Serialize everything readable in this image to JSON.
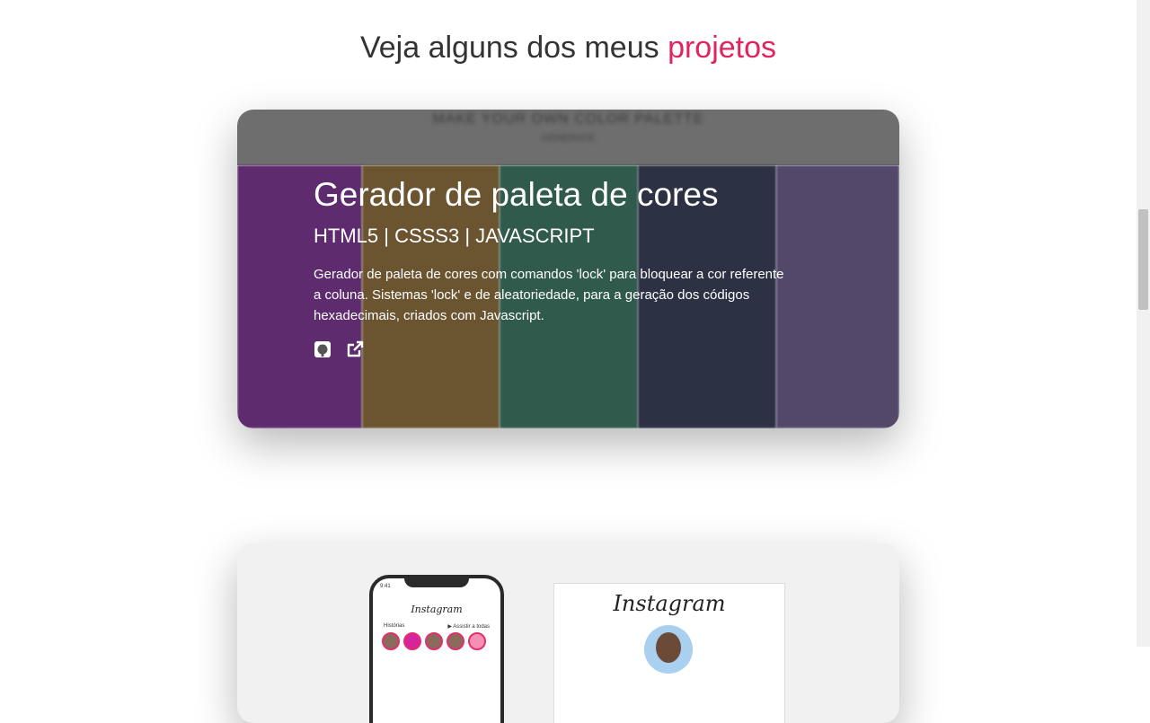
{
  "section": {
    "heading_prefix": "Veja alguns dos meus",
    "heading_accent": "projetos",
    "accent_color": "#e0245e"
  },
  "project": {
    "title": "Gerador de paleta de cores",
    "tech": "HTML5 | CSSS3 | JAVASCRIPT",
    "description": "Gerador de paleta de cores com comandos 'lock' para bloquear a cor referente a coluna. Sistemas 'lock' e de aleatoriedade, para a geração dos códigos hexadecimais, criados com Javascript.",
    "links": [
      {
        "icon": "github-icon"
      },
      {
        "icon": "external-link-icon"
      }
    ],
    "background_top_title": "MAKE YOUR OWN COLOR PALETTE",
    "background_top_subtitle": "GENERATE",
    "palette_colors": [
      "#5e2b6e",
      "#6b5430",
      "#2f5a4c",
      "#2c3244",
      "#53486a"
    ]
  },
  "project2": {
    "phone_status": "9:41",
    "phone_app_name": "Instagram",
    "phone_stories_label": "Histórias",
    "phone_watch_all": "▶ Assistir a todas",
    "card_logo": "Instagram"
  }
}
